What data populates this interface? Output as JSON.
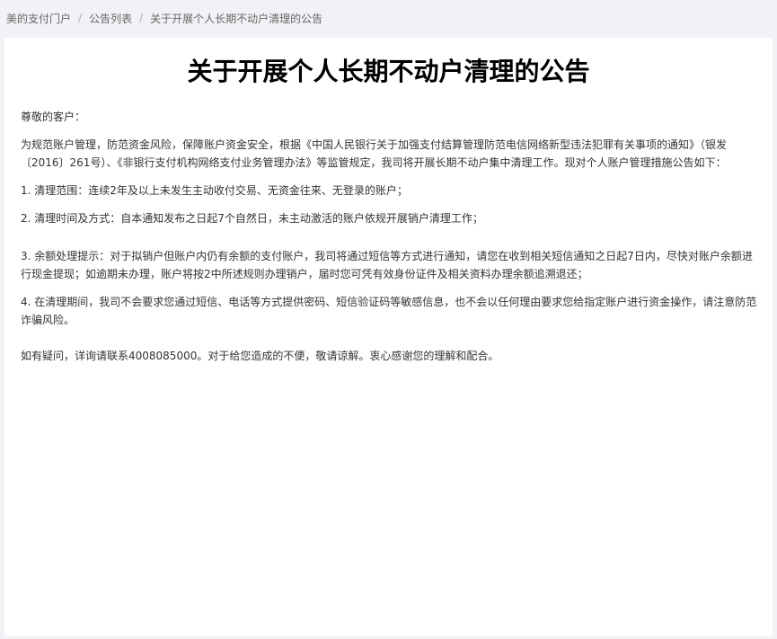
{
  "breadcrumb": {
    "items": [
      "美的支付门户",
      "公告列表"
    ],
    "current": "关于开展个人长期不动户清理的公告",
    "separator": "/"
  },
  "notice": {
    "title": "关于开展个人长期不动户清理的公告",
    "greeting": "尊敬的客户：",
    "intro": "为规范账户管理，防范资金风险，保障账户资金安全，根据《中国人民银行关于加强支付结算管理防范电信网络新型违法犯罪有关事项的通知》（银发〔2016〕261号）、《非银行支付机构网络支付业务管理办法》等监管规定，我司将开展长期不动户集中清理工作。现对个人账户管理措施公告如下：",
    "items": [
      "1. 清理范围：连续2年及以上未发生主动收付交易、无资金往来、无登录的账户；",
      "2. 清理时间及方式：自本通知发布之日起7个自然日，未主动激活的账户依规开展销户清理工作；",
      "3. 余额处理提示：对于拟销户但账户内仍有余额的支付账户，我司将通过短信等方式进行通知，请您在收到相关短信通知之日起7日内，尽快对账户余额进行现金提现；如逾期未办理，账户将按2中所述规则办理销户，届时您可凭有效身份证件及相关资料办理余额追溯退还；",
      "4. 在清理期间，我司不会要求您通过短信、电话等方式提供密码、短信验证码等敏感信息，也不会以任何理由要求您给指定账户进行资金操作，请注意防范诈骗风险。"
    ],
    "closing": "如有疑问，详询请联系4008085000。对于给您造成的不便，敬请谅解。衷心感谢您的理解和配合。"
  },
  "colors": {
    "page_background": "#f0f2f5",
    "card_background": "#ffffff",
    "title_text": "#000000",
    "body_text": "#333333",
    "breadcrumb_text": "#666666"
  }
}
